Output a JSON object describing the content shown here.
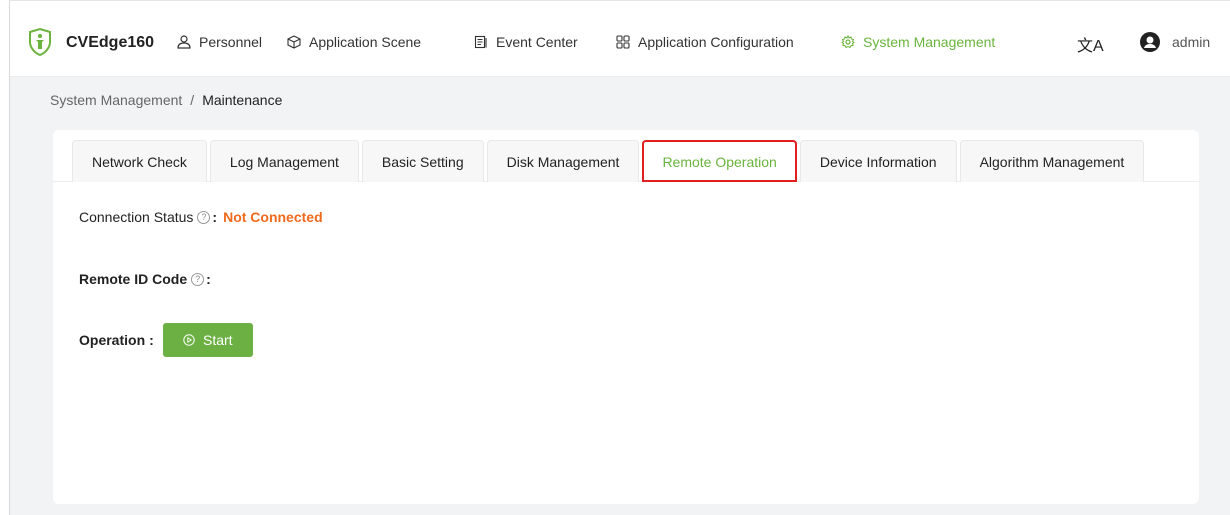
{
  "header": {
    "brand": "CVEdge160",
    "nav": [
      {
        "label": "Personnel",
        "icon": "user-outline-icon"
      },
      {
        "label": "Application Scene",
        "icon": "cube-icon"
      },
      {
        "label": "Event Center",
        "icon": "document-list-icon"
      },
      {
        "label": "Application Configuration",
        "icon": "grid-icon"
      },
      {
        "label": "System Management",
        "icon": "gear-icon",
        "active": true
      }
    ],
    "translate_icon": "文A",
    "user": "admin"
  },
  "breadcrumb": {
    "parent": "System Management",
    "separator": "/",
    "current": "Maintenance"
  },
  "tabs": [
    {
      "label": "Network Check"
    },
    {
      "label": "Log Management"
    },
    {
      "label": "Basic Setting"
    },
    {
      "label": "Disk Management"
    },
    {
      "label": "Remote Operation",
      "active": true
    },
    {
      "label": "Device Information"
    },
    {
      "label": "Algorithm Management"
    }
  ],
  "form": {
    "connection_label": "Connection Status",
    "connection_value": "Not Connected",
    "remote_id_label": "Remote ID Code",
    "operation_label": "Operation",
    "colon": ":",
    "start_label": "Start",
    "help_glyph": "?"
  },
  "colors": {
    "accent": "#6ab43e",
    "status_warning": "#f06a1e",
    "highlight_outline": "#e02020"
  }
}
